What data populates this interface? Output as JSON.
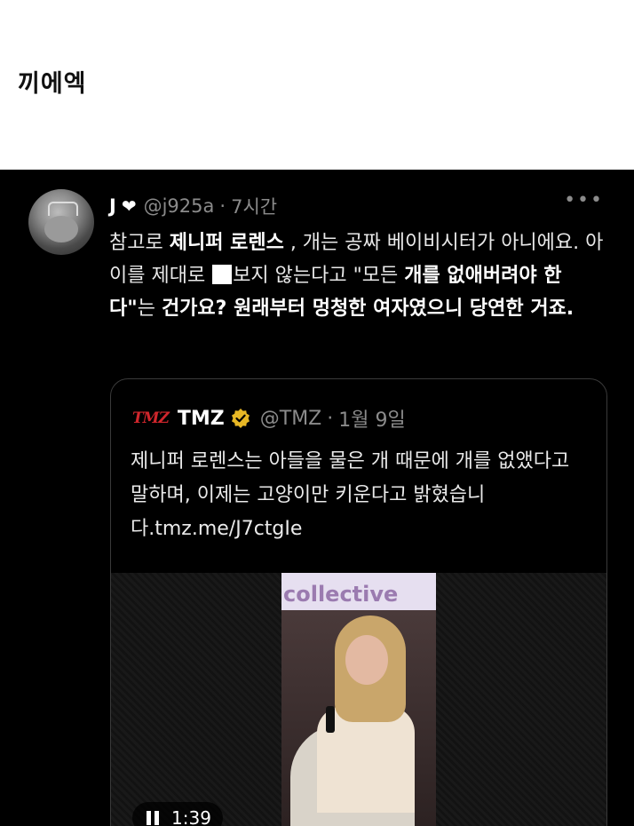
{
  "post": {
    "title": "끼에엑"
  },
  "tweet": {
    "name": "J",
    "heart": "❤",
    "handle": "@j925a",
    "sep": "·",
    "time": "7시간",
    "more": "•••",
    "text": {
      "p1": "참고로 ",
      "b1": "제니퍼 로렌스",
      "p2": " , 개는 공짜 베이비시터가 아니에요. 아이를 제대로 ",
      "p3": "보지 않는다고 \"모든 ",
      "b2": "개를 없애버려야 한다\"",
      "p4": "는 ",
      "b3": "건가요? 원래부터 멍청한 여자였으니 당연한 거죠."
    }
  },
  "quote": {
    "logo": "TMZ",
    "name": "TMZ",
    "handle": "@TMZ",
    "sep": "·",
    "date": "1월 9일",
    "text": "제니퍼 로렌스는 아들을 물은 개 때문에 개를 없앴다고 말하며, 이제는 고양이만 키운다고 밝혔습니다.tmz.me/J7ctgIe",
    "video": {
      "sign_text": "collective",
      "duration": "1:39"
    }
  },
  "colors": {
    "background": "#000000",
    "muted": "#8b8b8b",
    "verified": "#e8b825",
    "tmz_red": "#d0262c"
  }
}
